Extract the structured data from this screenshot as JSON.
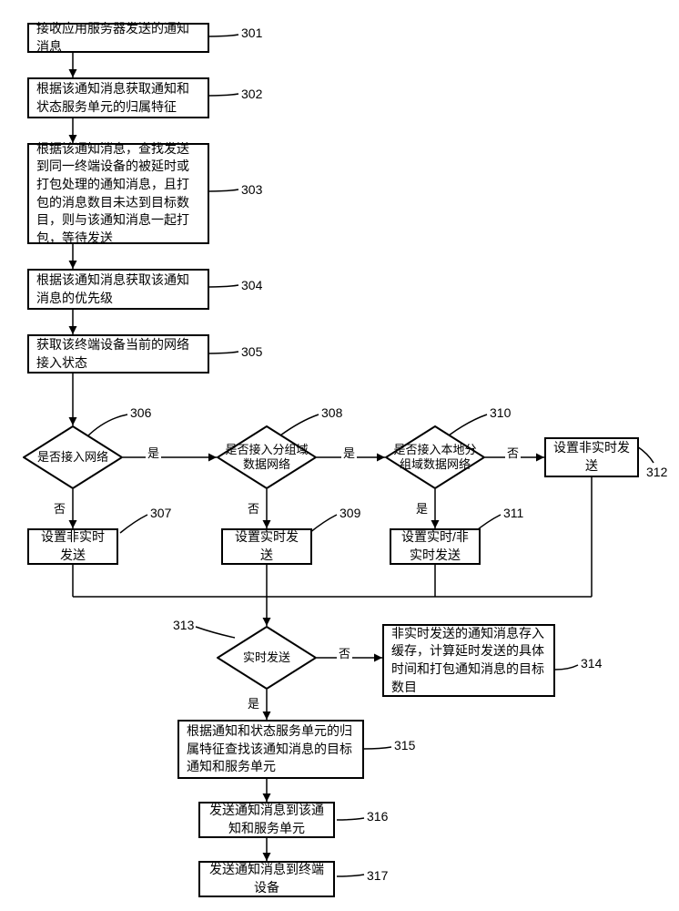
{
  "steps": {
    "s301": "接收应用服务器发送的通知消息",
    "s302": "根据该通知消息获取通知和状态服务单元的归属特征",
    "s303": "根据该通知消息，查找发送到同一终端设备的被延时或打包处理的通知消息，且打包的消息数目未达到目标数目，则与该通知消息一起打包，等待发送",
    "s304": "根据该通知消息获取该通知消息的优先级",
    "s305": "获取该终端设备当前的网络接入状态",
    "d306": "是否接入网络",
    "s307": "设置非实时发送",
    "d308": "是否接入分组域数据网络",
    "s309": "设置实时发送",
    "d310": "是否接入本地分组域数据网络",
    "s311": "设置实时/非实时发送",
    "s312": "设置非实时发送",
    "d313": "实时发送",
    "s314": "非实时发送的通知消息存入缓存，计算延时发送的具体时间和打包通知消息的目标数目",
    "s315": "根据通知和状态服务单元的归属特征查找该通知消息的目标通知和服务单元",
    "s316": "发送通知消息到该通知和服务单元",
    "s317": "发送通知消息到终端设备"
  },
  "labels": {
    "n301": "301",
    "n302": "302",
    "n303": "303",
    "n304": "304",
    "n305": "305",
    "n306": "306",
    "n307": "307",
    "n308": "308",
    "n309": "309",
    "n310": "310",
    "n311": "311",
    "n312": "312",
    "n313": "313",
    "n314": "314",
    "n315": "315",
    "n316": "316",
    "n317": "317"
  },
  "edge": {
    "yes": "是",
    "no": "否"
  }
}
